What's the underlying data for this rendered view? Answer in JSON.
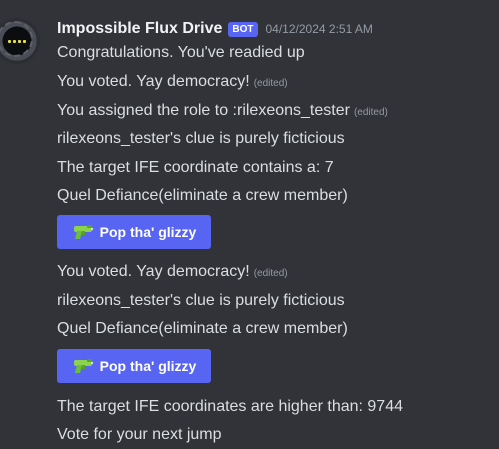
{
  "author": {
    "name": "Impossible Flux Drive",
    "tag": "BOT",
    "timestamp": "04/12/2024 2:51 AM"
  },
  "edited_label": "(edited)",
  "lines": [
    "Congratulations. You've readied up",
    "You voted. Yay democracy!",
    "You assigned the role to :rilexeons_tester",
    "rilexeons_tester's clue is purely ficticious",
    "The target IFE coordinate contains a: 7",
    "Quel Defiance(eliminate a crew member)",
    "You voted. Yay democracy!",
    "rilexeons_tester's clue is purely ficticious",
    "Quel Defiance(eliminate a crew member)",
    "The target IFE coordinates are higher than: 9744",
    "Vote for your next jump"
  ],
  "buttons": [
    {
      "label": "Pop tha' glizzy",
      "icon": "water-pistol-icon"
    },
    {
      "label": "Pop tha' glizzy",
      "icon": "water-pistol-icon"
    }
  ],
  "colors": {
    "background": "#313338",
    "accent": "#5865f2",
    "text": "#dbdee1",
    "muted": "#949ba4",
    "pistol": "#8bd34a"
  }
}
